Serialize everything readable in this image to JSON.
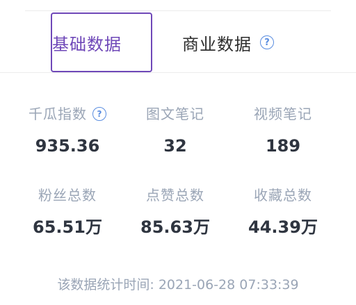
{
  "tabs": {
    "basic_label": "基础数据",
    "business_label": "商业数据",
    "help_glyph": "?"
  },
  "stats": [
    {
      "label": "千瓜指数",
      "value": "935.36",
      "has_help": true
    },
    {
      "label": "图文笔记",
      "value": "32"
    },
    {
      "label": "视频笔记",
      "value": "189"
    },
    {
      "label": "粉丝总数",
      "value": "65.51万"
    },
    {
      "label": "点赞总数",
      "value": "85.63万"
    },
    {
      "label": "收藏总数",
      "value": "44.39万"
    }
  ],
  "footer": {
    "text": "该数据统计时间: 2021-06-28 07:33:39"
  },
  "colors": {
    "accent": "#6f48b8",
    "help_icon": "#5a8de0",
    "label": "#9aa5b6",
    "value": "#2f3540"
  }
}
